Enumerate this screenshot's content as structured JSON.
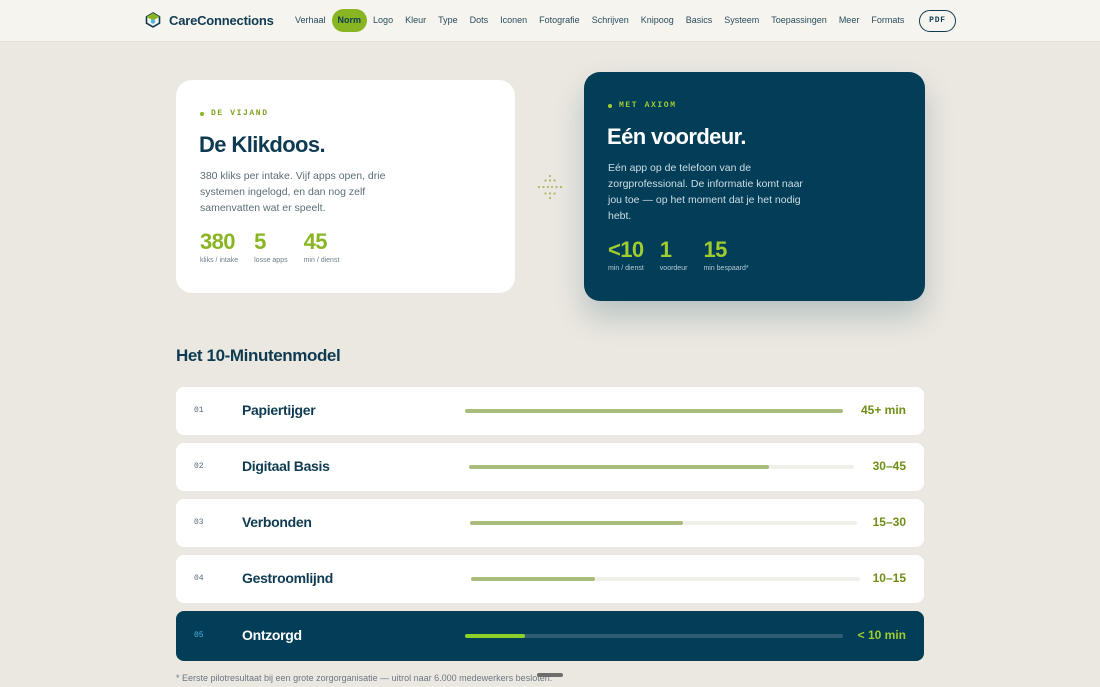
{
  "brand": {
    "name": "CareConnections"
  },
  "nav": {
    "items": [
      "Verhaal",
      "Norm",
      "Logo",
      "Kleur",
      "Type",
      "Dots",
      "Iconen",
      "Fotografie",
      "Schrijven",
      "Knipoog",
      "Basics",
      "Systeem",
      "Toepassingen",
      "Meer",
      "Formats"
    ],
    "active": "Norm",
    "pdf_label": "PDF"
  },
  "colors": {
    "accent_green": "#8ab523",
    "navy": "#033e58",
    "background": "#ebe8e1"
  },
  "enemy_card": {
    "eyebrow": "DE VIJAND",
    "title": "De Klikdoos.",
    "body": "380 kliks per intake. Vijf apps open, drie systemen ingelogd, en dan nog zelf samenvatten wat er speelt.",
    "stats": [
      {
        "value": "380",
        "label": "kliks / intake"
      },
      {
        "value": "5",
        "label": "losse apps"
      },
      {
        "value": "45",
        "label": "min / dienst"
      }
    ]
  },
  "axiom_card": {
    "eyebrow": "MET AXIOM",
    "title": "Eén voordeur.",
    "body": "Eén app op de telefoon van de zorgprofessional. De informatie komt naar jou toe — op het moment dat je het nodig hebt.",
    "stats": [
      {
        "value": "<10",
        "label": "min / dienst"
      },
      {
        "value": "1",
        "label": "voordeur"
      },
      {
        "value": "15",
        "label": "min bespaard*"
      }
    ]
  },
  "model": {
    "title": "Het 10-Minutenmodel",
    "levels": [
      {
        "num": "01",
        "name": "Papiertijger",
        "value": "45+ min",
        "fill": 1.0
      },
      {
        "num": "02",
        "name": "Digitaal Basis",
        "value": "30–45",
        "fill": 0.78
      },
      {
        "num": "03",
        "name": "Verbonden",
        "value": "15–30",
        "fill": 0.55
      },
      {
        "num": "04",
        "name": "Gestroomlijnd",
        "value": "10–15",
        "fill": 0.32
      },
      {
        "num": "05",
        "name": "Ontzorgd",
        "value": "< 10 min",
        "fill": 0.16
      }
    ]
  },
  "footnote": "* Eerste pilotresultaat bij een grote zorgorganisatie — uitrol naar 6.000 medewerkers besloten."
}
